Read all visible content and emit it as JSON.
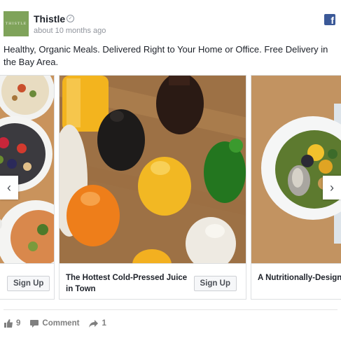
{
  "post": {
    "page_name": "Thistle",
    "avatar_text": "THISTLE",
    "timestamp": "about 10 months ago",
    "caption": "Healthy, Organic Meals. Delivered Right to Your Home or Office. Free Delivery in the Bay Area.",
    "platform_icon": "facebook-icon",
    "verified_icon": "check-circle-icon"
  },
  "carousel": {
    "cards": [
      {
        "title": "",
        "cta": "Sign Up",
        "image": "salad-bowls-photo"
      },
      {
        "title": "The Hottest Cold-Pressed Juice in Town",
        "cta": "Sign Up",
        "image": "juice-bottles-photo"
      },
      {
        "title": "A Nutritionally-Designe",
        "cta": "",
        "image": "grain-bowl-photo"
      }
    ],
    "prev_icon": "chevron-left-icon",
    "next_icon": "chevron-right-icon"
  },
  "actions": {
    "likes": "9",
    "comment_label": "Comment",
    "shares": "1"
  },
  "colors": {
    "facebook_blue": "#3b5998",
    "avatar_green": "#7fa35a",
    "text": "#1d2129",
    "muted": "#90949c"
  }
}
